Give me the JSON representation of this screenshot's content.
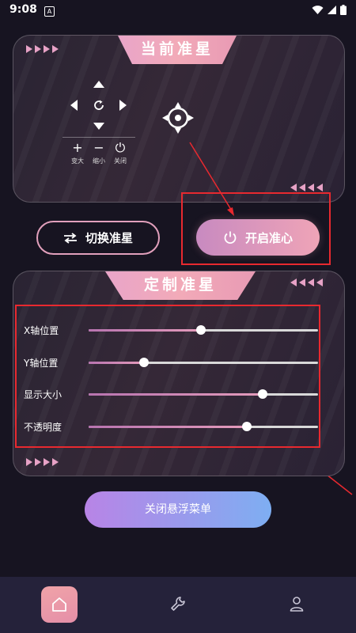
{
  "status_bar": {
    "time": "9:08",
    "notification_glyph": "A"
  },
  "current_crosshair": {
    "title": "当前准星",
    "controls": [
      {
        "symbol": "+",
        "label": "变大"
      },
      {
        "symbol": "−",
        "label": "缩小"
      },
      {
        "symbol": "⏻",
        "label": "关闭"
      }
    ],
    "crosshair_icon": "crosshair-icon"
  },
  "actions": {
    "switch_label": "切换准星",
    "switch_icon": "switch-arrows-icon",
    "enable_label": "开启准心",
    "enable_icon": "power-icon"
  },
  "custom_crosshair": {
    "title": "定制准星",
    "sliders": [
      {
        "label": "X轴位置",
        "value": 0.49
      },
      {
        "label": "Y轴位置",
        "value": 0.24
      },
      {
        "label": "显示大小",
        "value": 0.76
      },
      {
        "label": "不透明度",
        "value": 0.69
      }
    ]
  },
  "close_menu_label": "关闭悬浮菜单",
  "bottom_nav": [
    {
      "name": "home",
      "icon": "home-icon",
      "active": true
    },
    {
      "name": "tools",
      "icon": "wrench-icon",
      "active": false
    },
    {
      "name": "profile",
      "icon": "person-icon",
      "active": false
    }
  ],
  "colors": {
    "accent_pink": "#efa4b7",
    "annotation_red": "#e8292f",
    "nav_bg": "#25223a"
  }
}
